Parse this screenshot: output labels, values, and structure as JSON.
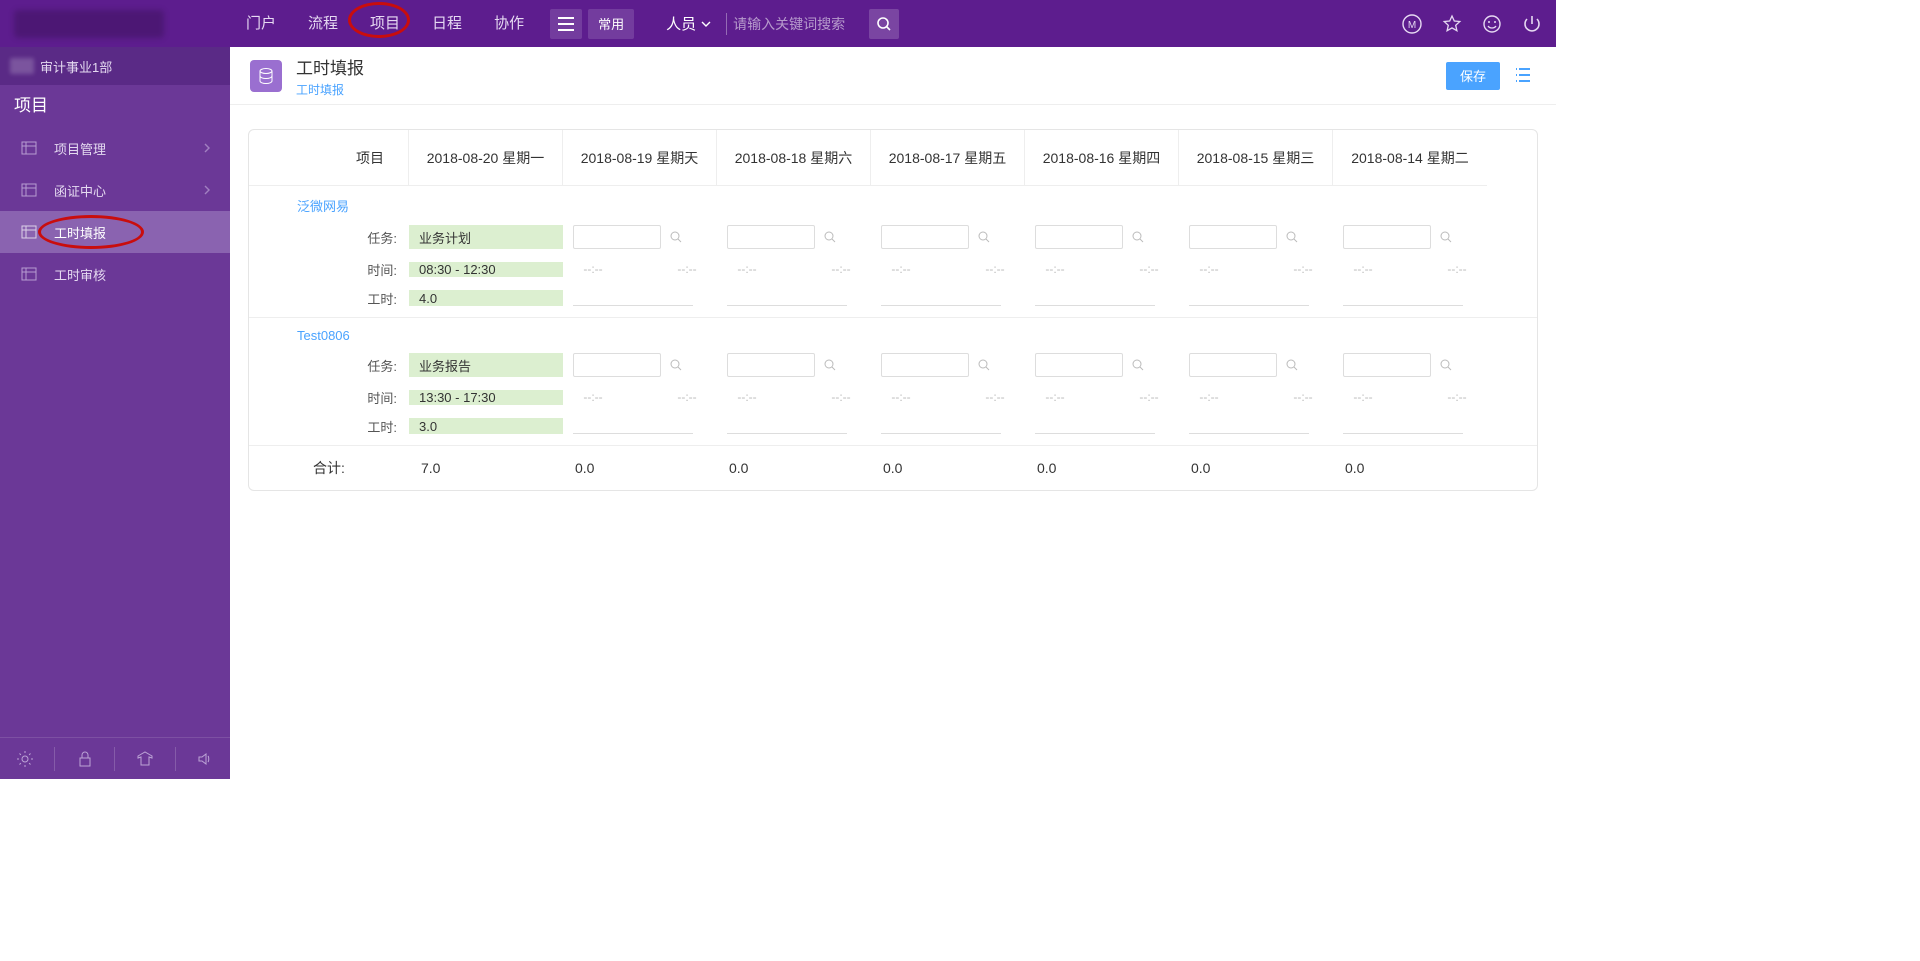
{
  "top_nav": [
    "门户",
    "流程",
    "项目",
    "日程",
    "协作"
  ],
  "top_nav_active_index": 2,
  "common_button": "常用",
  "search": {
    "type": "人员",
    "placeholder": "请输入关键词搜索"
  },
  "dept": {
    "name": "审计事业1部"
  },
  "sidebar": {
    "section": "项目",
    "items": [
      {
        "label": "项目管理",
        "has_children": true
      },
      {
        "label": "函证中心",
        "has_children": true
      },
      {
        "label": "工时填报",
        "has_children": false,
        "active": true,
        "circled": true
      },
      {
        "label": "工时审核",
        "has_children": false
      }
    ]
  },
  "page": {
    "title": "工时填报",
    "breadcrumb": "工时填报",
    "save_label": "保存"
  },
  "timesheet": {
    "project_header": "项目",
    "days": [
      "2018-08-20 星期一",
      "2018-08-19 星期天",
      "2018-08-18 星期六",
      "2018-08-17 星期五",
      "2018-08-16 星期四",
      "2018-08-15 星期三",
      "2018-08-14 星期二"
    ],
    "field_labels": {
      "task": "任务:",
      "time": "时间:",
      "hours": "工时:"
    },
    "empty_time": "--:--",
    "projects": [
      {
        "name": "泛微网易",
        "day0": {
          "task": "业务计划",
          "time": "08:30 - 12:30",
          "hours": "4.0"
        }
      },
      {
        "name": "Test0806",
        "day0": {
          "task": "业务报告",
          "time": "13:30 - 17:30",
          "hours": "3.0"
        }
      }
    ],
    "total_label": "合计:",
    "totals": [
      "7.0",
      "0.0",
      "0.0",
      "0.0",
      "0.0",
      "0.0",
      "0.0"
    ]
  }
}
